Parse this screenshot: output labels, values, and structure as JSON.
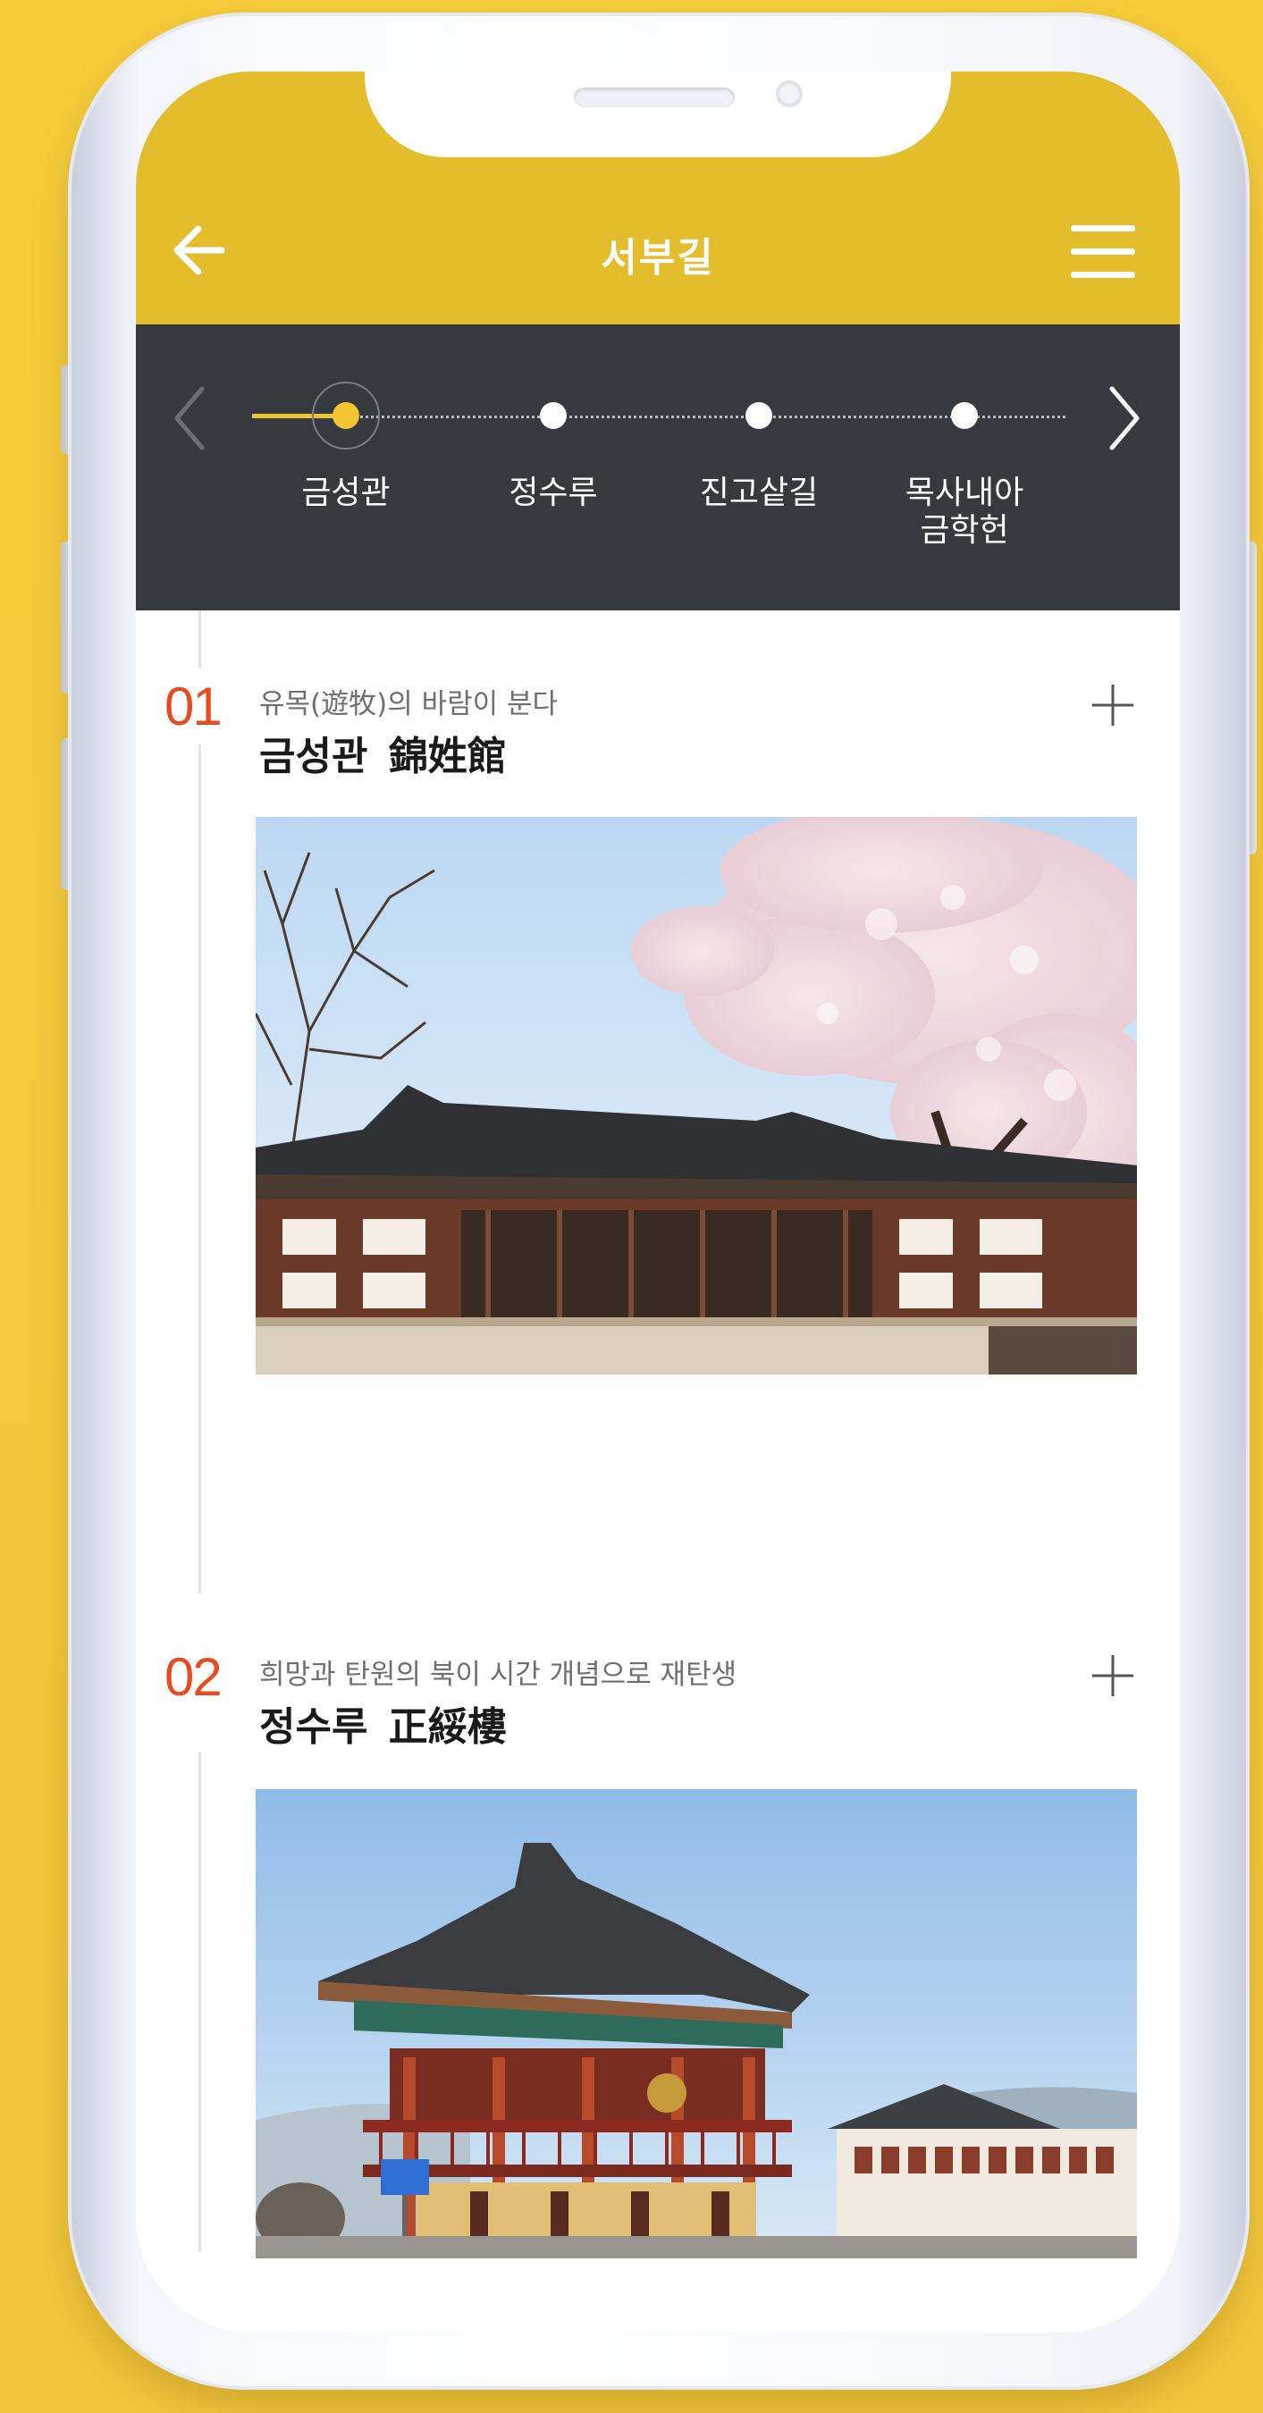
{
  "header": {
    "title": "서부길"
  },
  "stepper": {
    "steps": [
      {
        "label": "금성관",
        "active": true
      },
      {
        "label": "정수루",
        "active": false
      },
      {
        "label": "진고샅길",
        "active": false
      },
      {
        "label_line1": "목사내아",
        "label_line2": "금학헌",
        "active": false
      }
    ]
  },
  "entries": [
    {
      "number": "01",
      "subtitle": "유목(遊牧)의 바람이 분다",
      "title": "금성관  錦姓館"
    },
    {
      "number": "02",
      "subtitle": "희망과 탄원의 북이 시간 개념으로 재탄생",
      "title": "정수루  正綏樓"
    }
  ],
  "colors": {
    "header": "#e3bd2c",
    "stepper": "#363a3f",
    "accent": "#f2c531",
    "number": "#e94b21",
    "background": "#f5ca3c"
  }
}
